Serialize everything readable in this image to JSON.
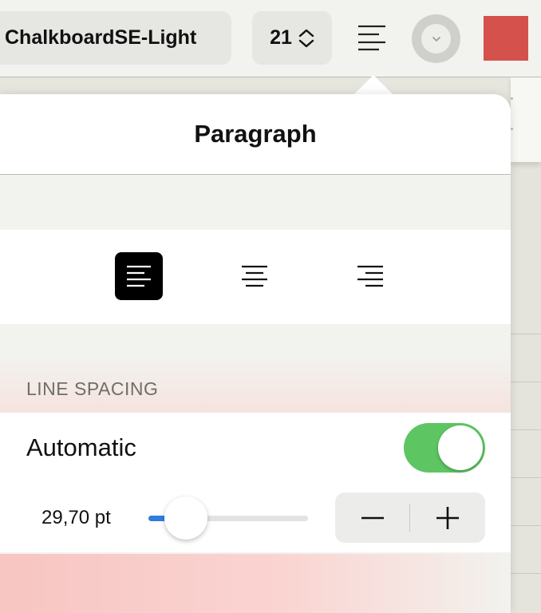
{
  "toolbar": {
    "font_name": "ChalkboardSE-Light",
    "font_size": "21",
    "current_color": "#d5514b"
  },
  "popover": {
    "title": "Paragraph",
    "alignment": {
      "options": [
        "left",
        "center",
        "right"
      ],
      "selected": "left"
    },
    "line_spacing": {
      "section_label": "LINE SPACING",
      "automatic_label": "Automatic",
      "automatic_on": true,
      "value_text": "29,70 pt",
      "toggle_color": "#5dc663",
      "slider_color": "#2f7de1"
    }
  }
}
